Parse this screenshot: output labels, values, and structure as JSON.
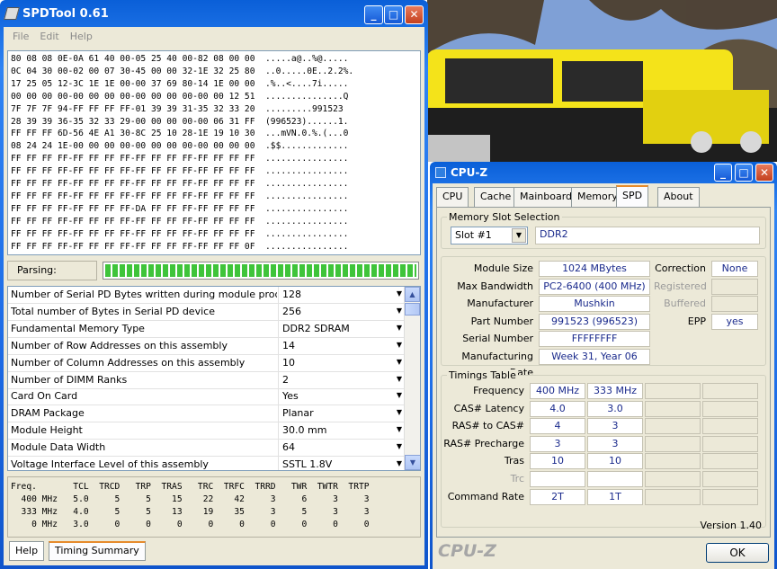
{
  "spdtool": {
    "title": "SPDTool 0.61",
    "menu": [
      "File",
      "Edit",
      "Help"
    ],
    "hex_lines": [
      "80 08 08 0E-0A 61 40 00-05 25 40 00-82 08 00 00  .....a@..%@.....",
      "0C 04 30 00-02 00 07 30-45 00 00 32-1E 32 25 80  ..0.....0E..2.2%.",
      "17 25 05 12-3C 1E 1E 00-00 37 69 80-14 1E 00 00  .%..<....7i.....",
      "00 00 00 00-00 00 00 00-00 00 00 00-00 00 12 51  ...............Q",
      "7F 7F 7F 94-FF FF FF FF-01 39 39 31-35 32 33 20  .........991523 ",
      "28 39 39 36-35 32 33 29-00 00 00 00-00 06 31 FF  (996523)......1.",
      "FF FF FF 6D-56 4E A1 30-8C 25 10 28-1E 19 10 30  ...mVN.0.%.(...0",
      "08 24 24 1E-00 00 00 00-00 00 00 00-00 00 00 00  .$$.............",
      "FF FF FF FF-FF FF FF FF-FF FF FF FF-FF FF FF FF  ................",
      "FF FF FF FF-FF FF FF FF-FF FF FF FF-FF FF FF FF  ................",
      "FF FF FF FF-FF FF FF FF-FF FF FF FF-FF FF FF FF  ................",
      "FF FF FF FF-FF FF FF FF-FF FF FF FF-FF FF FF FF  ................",
      "FF FF FF FF-FF FF FF FF-DA FF FF FF-FF FF FF FF  ................",
      "FF FF FF FF-FF FF FF FF-FF FF FF FF-FF FF FF FF  ................",
      "FF FF FF FF-FF FF FF FF-FF FF FF FF-FF FF FF FF  ................",
      "FF FF FF FF-FF FF FF FF-FF FF FF FF-FF FF FF 0F  ................"
    ],
    "parsing_label": "Parsing:",
    "progress": 1.0,
    "rows": [
      {
        "label": "Number of Serial PD Bytes written during module production",
        "value": "128"
      },
      {
        "label": "Total number of Bytes in Serial PD device",
        "value": "256"
      },
      {
        "label": "Fundamental Memory Type",
        "value": "DDR2 SDRAM"
      },
      {
        "label": "Number of Row Addresses on this assembly",
        "value": "14"
      },
      {
        "label": "Number of Column Addresses on this assembly",
        "value": "10"
      },
      {
        "label": "Number of DIMM Ranks",
        "value": "2"
      },
      {
        "label": "Card On Card",
        "value": "Yes"
      },
      {
        "label": "DRAM Package",
        "value": "Planar"
      },
      {
        "label": "Module Height",
        "value": "30.0 mm"
      },
      {
        "label": "Module Data Width",
        "value": "64"
      },
      {
        "label": "Voltage Interface Level of this assembly",
        "value": "SSTL 1.8V"
      }
    ],
    "timing_summary": [
      "Freq.       TCL  TRCD   TRP  TRAS   TRC  TRFC  TRRD   TWR  TWTR  TRTP",
      "  400 MHz   5.0     5     5    15    22    42     3     6     3     3",
      "  333 MHz   4.0     5     5    13    19    35     3     5     3     3",
      "    0 MHz   3.0     0     0     0     0     0     0     0     0     0"
    ],
    "tabs": [
      "Help",
      "Timing Summary"
    ]
  },
  "cpuz": {
    "title": "CPU-Z",
    "tabs": [
      "CPU",
      "Cache",
      "Mainboard",
      "Memory",
      "SPD",
      "About"
    ],
    "active_tab": "SPD",
    "slot_group": "Memory Slot Selection",
    "slot_value": "Slot #1",
    "slot_type": "DDR2",
    "module": {
      "size_label": "Module Size",
      "size": "1024 MBytes",
      "bw_label": "Max Bandwidth",
      "bw": "PC2-6400 (400 MHz)",
      "mfr_label": "Manufacturer",
      "mfr": "Mushkin",
      "part_label": "Part Number",
      "part": "991523 (996523)",
      "serial_label": "Serial Number",
      "serial": "FFFFFFFF",
      "date_label": "Manufacturing Date",
      "date": "Week 31, Year 06",
      "correction_label": "Correction",
      "correction": "None",
      "registered_label": "Registered",
      "buffered_label": "Buffered",
      "epp_label": "EPP",
      "epp": "yes"
    },
    "timings_group": "Timings Table",
    "timings": [
      {
        "label": "Frequency",
        "v1": "400 MHz",
        "v2": "333 MHz"
      },
      {
        "label": "CAS# Latency",
        "v1": "4.0",
        "v2": "3.0"
      },
      {
        "label": "RAS# to CAS#",
        "v1": "4",
        "v2": "3"
      },
      {
        "label": "RAS# Precharge",
        "v1": "3",
        "v2": "3"
      },
      {
        "label": "Tras",
        "v1": "10",
        "v2": "10"
      },
      {
        "label": "Trc",
        "v1": "",
        "v2": ""
      },
      {
        "label": "Command Rate",
        "v1": "2T",
        "v2": "1T"
      }
    ],
    "version": "Version 1.40",
    "brand": "CPU-Z",
    "ok": "OK"
  },
  "colors": {
    "progress": "#3fc43a",
    "window_blue": "#1d6ce6",
    "value_text": "#1a2a8c"
  }
}
